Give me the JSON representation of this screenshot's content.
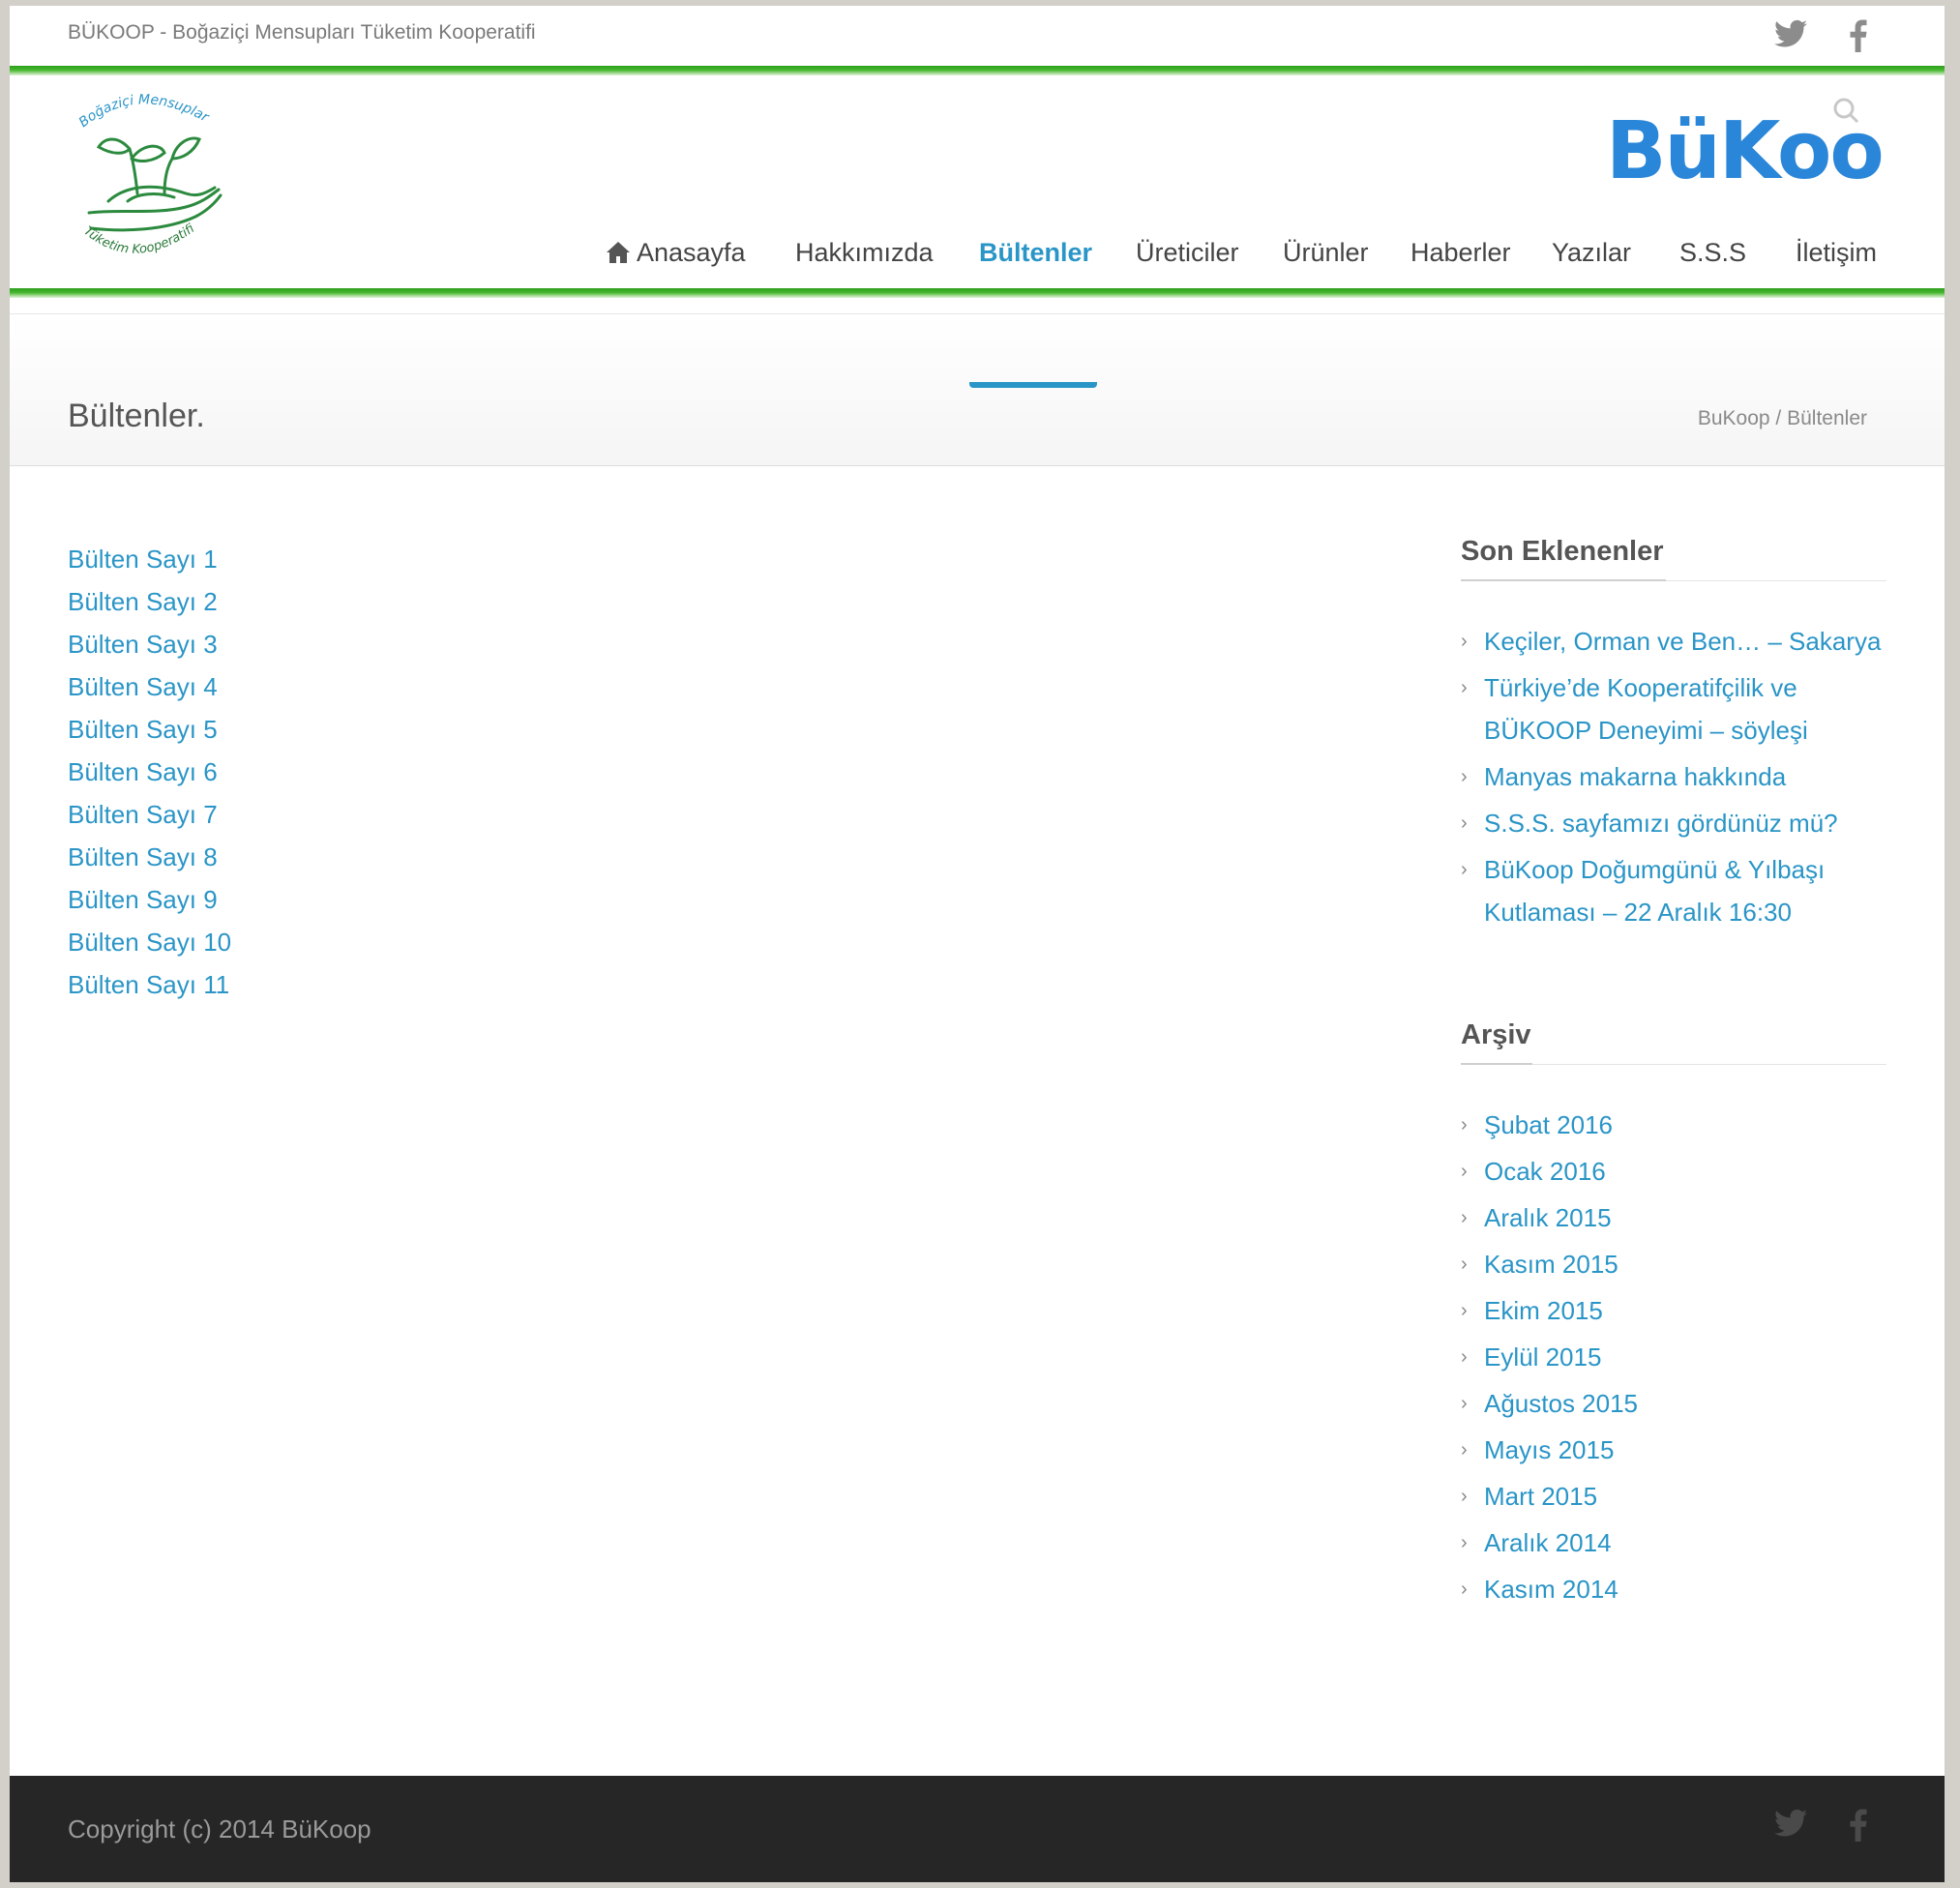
{
  "topbar": {
    "site_tagline": "BÜKOOP - Boğaziçi Mensupları Tüketim Kooperatifi"
  },
  "logos": {
    "left_text_top": "Boğaziçi Mensupları",
    "left_text_bottom": "Tüketim Kooperatifi",
    "right_text": "BüKooP"
  },
  "nav": {
    "items": [
      {
        "label": "Anasayfa",
        "icon": "home-icon"
      },
      {
        "label": "Hakkımızda"
      },
      {
        "label": "Bültenler",
        "active": true
      },
      {
        "label": "Üreticiler"
      },
      {
        "label": "Ürünler"
      },
      {
        "label": "Haberler"
      },
      {
        "label": "Yazılar"
      },
      {
        "label": "S.S.S"
      },
      {
        "label": "İletişim"
      }
    ]
  },
  "page": {
    "title": "Bültenler.",
    "breadcrumb_home": "BuKoop",
    "breadcrumb_sep": "/",
    "breadcrumb_current": "Bültenler"
  },
  "bulletins": [
    "Bülten Sayı 1",
    "Bülten Sayı 2",
    "Bülten Sayı 3",
    "Bülten Sayı 4",
    "Bülten Sayı 5",
    "Bülten Sayı 6",
    "Bülten Sayı 7",
    "Bülten Sayı 8",
    "Bülten Sayı 9",
    "Bülten Sayı 10",
    "Bülten Sayı 11"
  ],
  "sidebar": {
    "recent_title": "Son Eklenenler",
    "recent": [
      [
        "Keçiler, Orman ve Ben… – Sakarya"
      ],
      [
        "Türkiye’de Kooperatifçilik ve",
        "BÜKOOP Deneyimi – söyleşi"
      ],
      [
        "Manyas makarna hakkında"
      ],
      [
        "S.S.S. sayfamızı gördünüz mü?"
      ],
      [
        "BüKoop Doğumgünü & Yılbaşı",
        "Kutlaması – 22 Aralık 16:30"
      ]
    ],
    "archive_title": "Arşiv",
    "archive": [
      "Şubat 2016",
      "Ocak 2016",
      "Aralık 2015",
      "Kasım 2015",
      "Ekim 2015",
      "Eylül 2015",
      "Ağustos 2015",
      "Mayıs 2015",
      "Mart 2015",
      "Aralık 2014",
      "Kasım 2014"
    ]
  },
  "footer": {
    "copyright": "Copyright (c) 2014 BüKoop"
  },
  "colors": {
    "accent": "#2a95c7",
    "green": "#3aa826",
    "footer_bg": "#262626"
  }
}
